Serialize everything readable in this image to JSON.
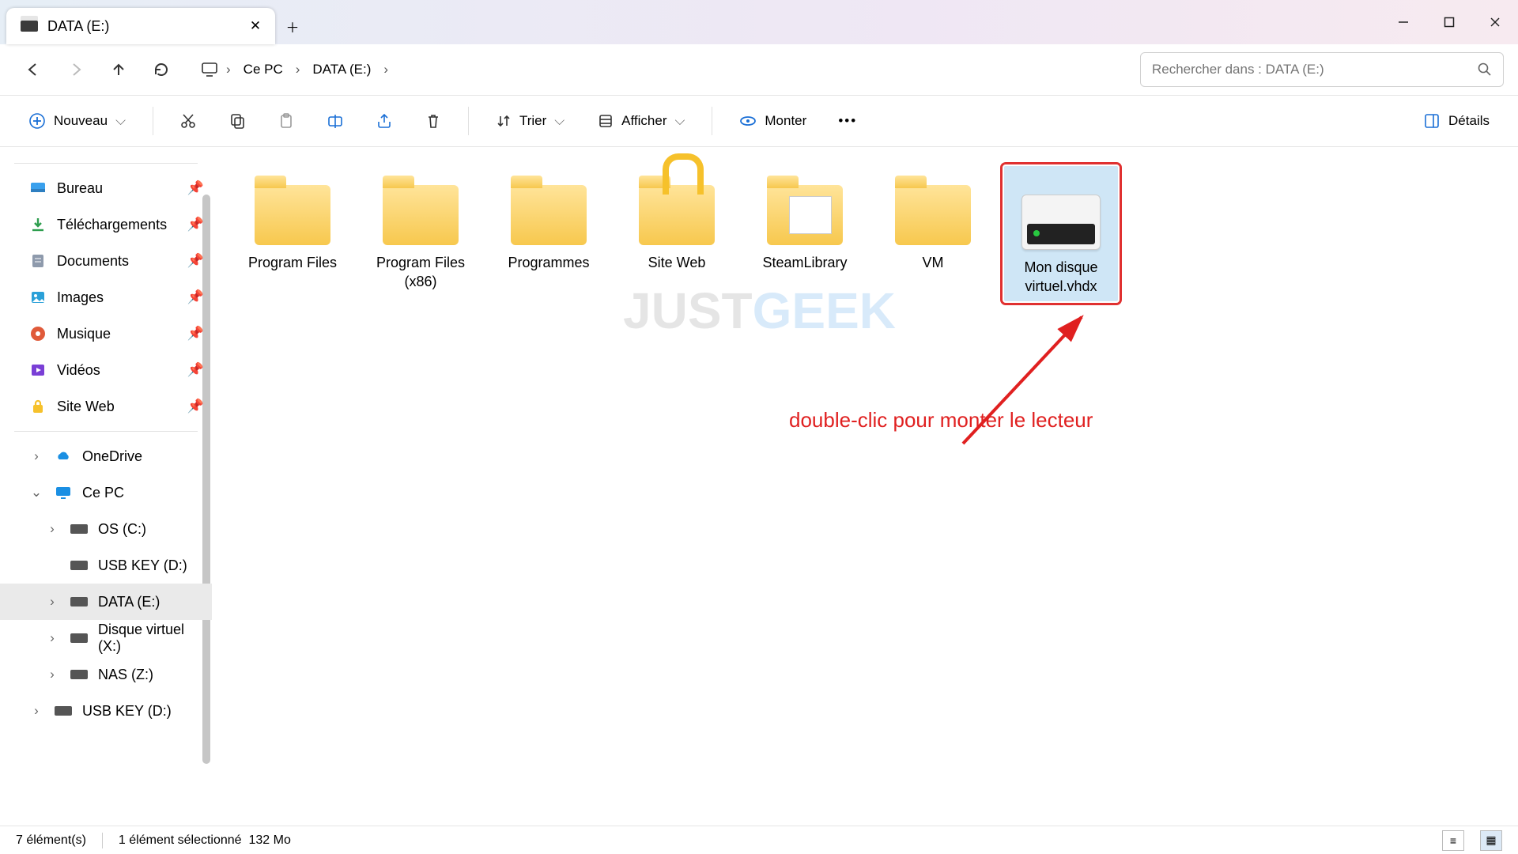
{
  "window": {
    "title": "DATA (E:)"
  },
  "nav": {
    "back": "←",
    "forward": "→",
    "up": "↑",
    "refresh": "⟳"
  },
  "breadcrumb": {
    "segments": [
      {
        "label": "Ce PC"
      },
      {
        "label": "DATA (E:)"
      }
    ]
  },
  "search": {
    "placeholder": "Rechercher dans : DATA (E:)"
  },
  "toolbar": {
    "new_label": "Nouveau",
    "sort_label": "Trier",
    "view_label": "Afficher",
    "mount_label": "Monter",
    "details_label": "Détails"
  },
  "sidebar": {
    "quick": [
      {
        "id": "bureau",
        "label": "Bureau",
        "pinned": true
      },
      {
        "id": "downloads",
        "label": "Téléchargements",
        "pinned": true
      },
      {
        "id": "documents",
        "label": "Documents",
        "pinned": true
      },
      {
        "id": "images",
        "label": "Images",
        "pinned": true
      },
      {
        "id": "musique",
        "label": "Musique",
        "pinned": true
      },
      {
        "id": "videos",
        "label": "Vidéos",
        "pinned": true
      },
      {
        "id": "siteweb",
        "label": "Site Web",
        "pinned": true
      }
    ],
    "tree": [
      {
        "label": "OneDrive",
        "depth": 1,
        "chevron": true
      },
      {
        "label": "Ce PC",
        "depth": 1,
        "chevron": true,
        "expanded": true
      },
      {
        "label": "OS (C:)",
        "depth": 2,
        "chevron": true
      },
      {
        "label": "USB KEY (D:)",
        "depth": 2,
        "chevron": false
      },
      {
        "label": "DATA (E:)",
        "depth": 2,
        "chevron": true,
        "selected": true
      },
      {
        "label": "Disque virtuel (X:)",
        "depth": 2,
        "chevron": true
      },
      {
        "label": "NAS (Z:)",
        "depth": 2,
        "chevron": true
      },
      {
        "label": "USB KEY (D:)",
        "depth": 1,
        "chevron": true
      }
    ]
  },
  "items": [
    {
      "name": "Program Files",
      "kind": "folder"
    },
    {
      "name": "Program Files (x86)",
      "kind": "folder"
    },
    {
      "name": "Programmes",
      "kind": "folder"
    },
    {
      "name": "Site Web",
      "kind": "folder-lock"
    },
    {
      "name": "SteamLibrary",
      "kind": "folder-doc"
    },
    {
      "name": "VM",
      "kind": "folder"
    },
    {
      "name": "Mon disque virtuel.vhdx",
      "kind": "vhd",
      "selected": true
    }
  ],
  "annotation": {
    "text": "double-clic pour monter le lecteur"
  },
  "watermark": {
    "a": "JUST",
    "b": "GEEK"
  },
  "status": {
    "total": "7 élément(s)",
    "selected": "1 élément sélectionné",
    "size": "132 Mo"
  }
}
